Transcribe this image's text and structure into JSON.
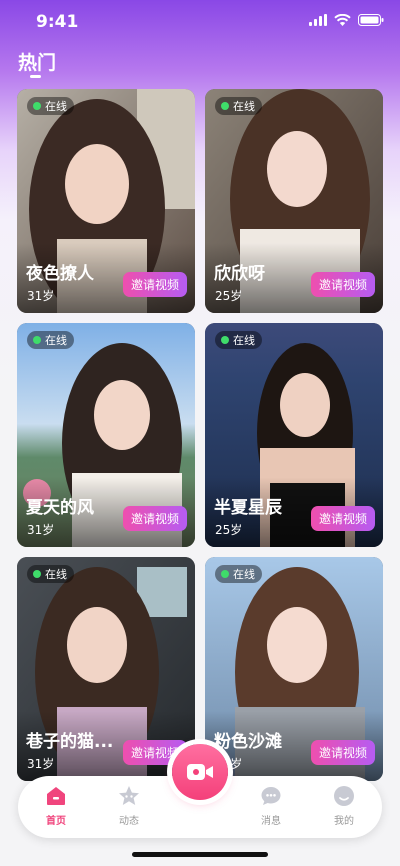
{
  "status_bar": {
    "time": "9:41"
  },
  "header": {
    "title": "热门"
  },
  "cards": [
    {
      "name": "夜色撩人",
      "age": "31岁",
      "online": "在线",
      "invite": "邀请视频"
    },
    {
      "name": "欣欣呀",
      "age": "25岁",
      "online": "在线",
      "invite": "邀请视频"
    },
    {
      "name": "夏天的风",
      "age": "31岁",
      "online": "在线",
      "invite": "邀请视频"
    },
    {
      "name": "半夏星辰",
      "age": "25岁",
      "online": "在线",
      "invite": "邀请视频"
    },
    {
      "name": "巷子的猫...",
      "age": "31岁",
      "online": "在线",
      "invite": "邀请视频"
    },
    {
      "name": "粉色沙滩",
      "age": "25岁",
      "online": "在线",
      "invite": "邀请视频"
    }
  ],
  "tab_bar": {
    "items": [
      {
        "label": "首页",
        "icon": "home-icon",
        "active": true
      },
      {
        "label": "动态",
        "icon": "star-icon",
        "active": false
      },
      {
        "label": "消息",
        "icon": "message-icon",
        "active": false
      },
      {
        "label": "我的",
        "icon": "profile-icon",
        "active": false
      }
    ],
    "center_icon": "video-camera-icon"
  },
  "colors": {
    "header_gradient_top": "#8a48e6",
    "online": "#3fdc6a",
    "invite_start": "#ee4fae",
    "invite_end": "#b65cf2",
    "accent": "#f0457d"
  }
}
